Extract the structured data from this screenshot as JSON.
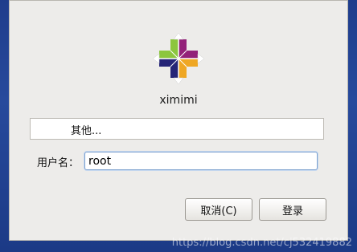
{
  "host": {
    "name": "ximimi"
  },
  "user_list": {
    "other_label": "其他..."
  },
  "login_form": {
    "username_label": "用户名：",
    "username_value": "root"
  },
  "buttons": {
    "cancel_label": "取消(C)",
    "login_label": "登录"
  },
  "watermark": {
    "text": "https://blog.csdn.net/cj532419882"
  },
  "colors": {
    "background": "#1f3d8c",
    "dialog": "#edecea",
    "logo_green": "#8cc63e",
    "logo_purple": "#932279",
    "logo_orange": "#efa724",
    "logo_blue": "#262577"
  }
}
